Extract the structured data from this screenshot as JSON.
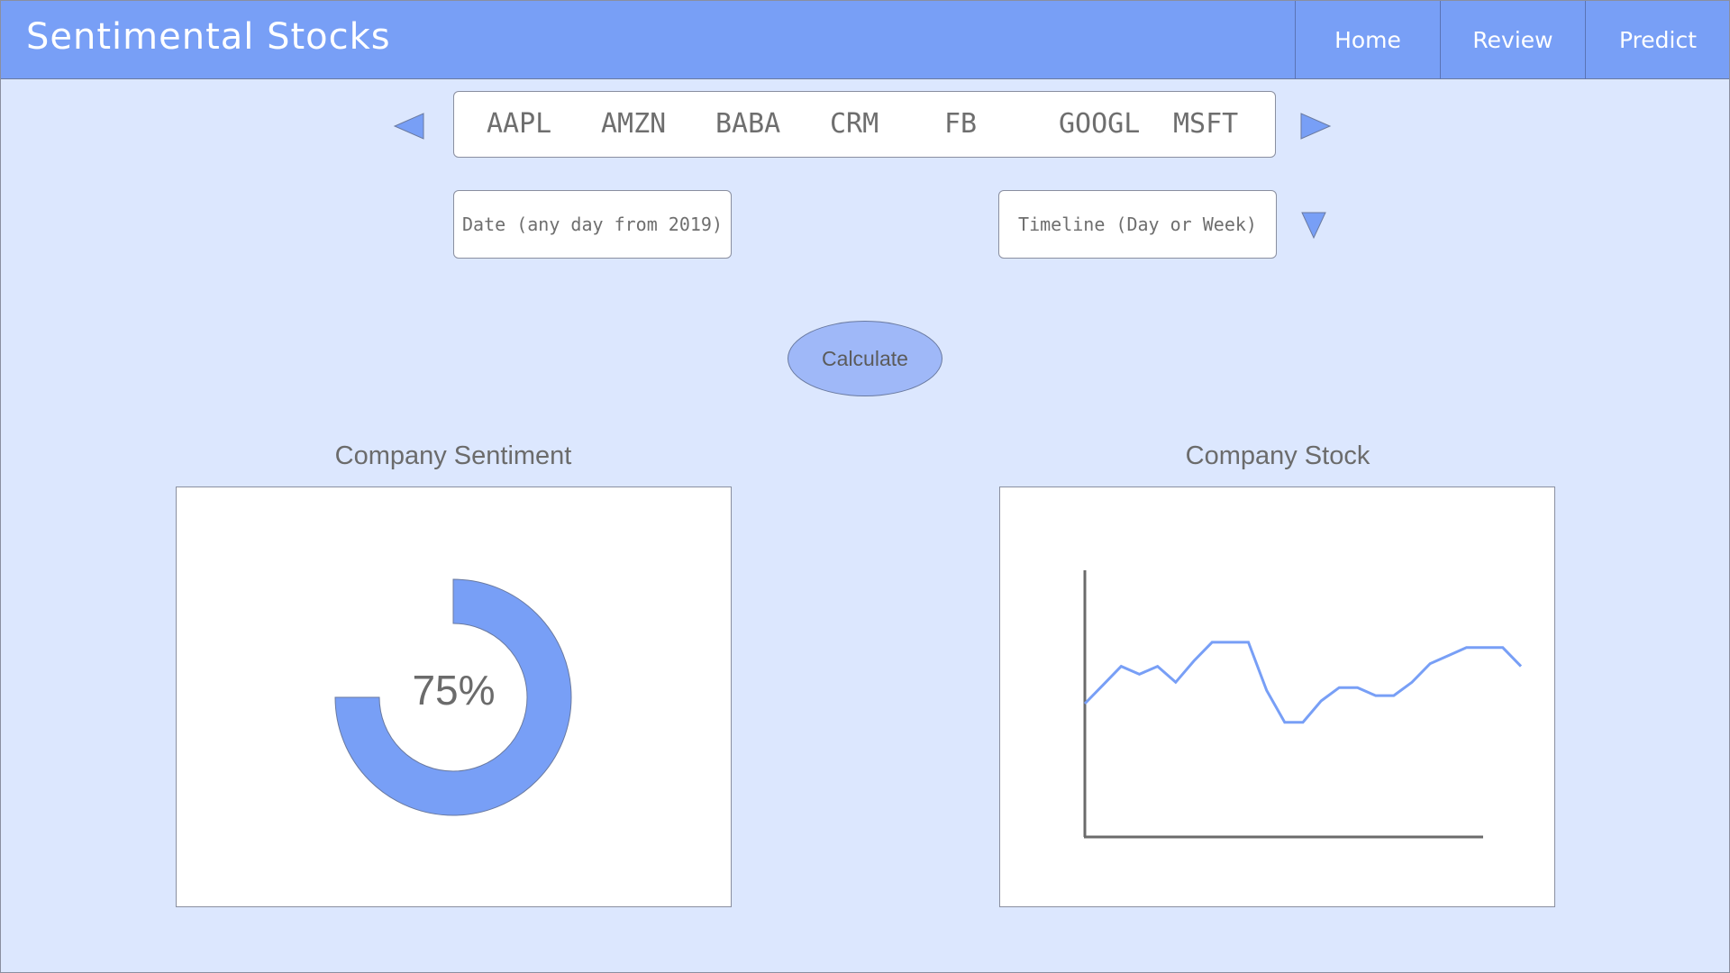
{
  "header": {
    "app_title": "Sentimental Stocks",
    "nav": [
      "Home",
      "Review",
      "Predict"
    ]
  },
  "tickers": [
    "AAPL",
    "AMZN",
    "BABA",
    "CRM",
    "FB",
    "GOOGL",
    "MSFT"
  ],
  "inputs": {
    "date_placeholder": "Date (any day from 2019)",
    "timeline_placeholder": "Timeline (Day or Week)"
  },
  "calculate_label": "Calculate",
  "sentiment": {
    "title": "Company Sentiment",
    "percent_label": "75%",
    "fraction": 0.75
  },
  "stock": {
    "title": "Company Stock"
  },
  "chart_data": {
    "type": "line",
    "title": "Company Stock",
    "xlabel": "",
    "ylabel": "",
    "grid": false,
    "legend": "none",
    "x": [
      0,
      1,
      2,
      3,
      4,
      5,
      6,
      7,
      8,
      9,
      10,
      11,
      12,
      13,
      14,
      15,
      16,
      17,
      18,
      19,
      20,
      21,
      22,
      23,
      24
    ],
    "series": [
      {
        "values": [
          50,
          57,
          64,
          61,
          64,
          58,
          66,
          73,
          73,
          73,
          55,
          43,
          43,
          51,
          56,
          56,
          53,
          53,
          58,
          65,
          68,
          71,
          71,
          71,
          64
        ]
      }
    ],
    "ylim": [
      0,
      100
    ],
    "color": "#789ff6"
  },
  "colors": {
    "header": "#789ff6",
    "background": "#dce7fe",
    "accent": "#789ff6"
  },
  "icons": {
    "left": "triangle-left-icon",
    "right": "triangle-right-icon",
    "dropdown": "triangle-down-icon"
  }
}
